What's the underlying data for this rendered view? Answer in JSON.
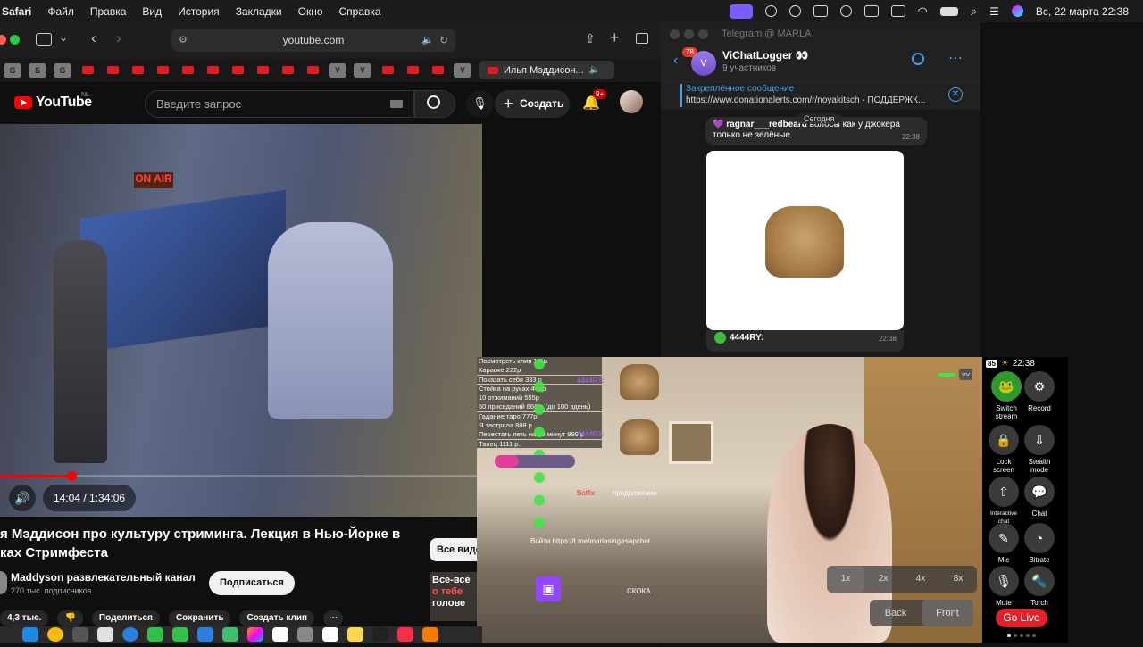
{
  "menubar": {
    "app": "Safari",
    "items": [
      "Файл",
      "Правка",
      "Вид",
      "История",
      "Закладки",
      "Окно",
      "Справка"
    ],
    "datetime": "Вс, 22 марта  22:38"
  },
  "safari": {
    "url": "youtube.com",
    "active_tab_title": "Илья Мэддисон..."
  },
  "youtube": {
    "logo_text": "YouTube",
    "region": "NL",
    "search_placeholder": "Введите запрос",
    "create_label": "Создать",
    "notifications_badge": "9+",
    "player": {
      "current_time": "14:04",
      "duration": "1:34:06",
      "progress_fraction": 0.149
    },
    "title_line1": "я Мэддисон про культуру стриминга. Лекция в Нью-Йорке в",
    "title_line2": "ках Стримфеста",
    "channel_name": "Maddyson развлекательный канал",
    "subscribers": "270 тыс. подписчиков",
    "subscribe_label": "Подписаться",
    "likes": "4,3 тыс.",
    "share_label": "Поделиться",
    "save_label": "Сохранить",
    "clip_label": "Создать клип",
    "see_all_label": "Все видео",
    "side_thumb_text_1": "Все-все",
    "side_thumb_text_2": "о тебе",
    "side_thumb_text_3": "голове"
  },
  "telegram": {
    "window_title": "Telegram @ MARLA",
    "unread_badge": "78",
    "chat_name": "ViChatLogger 👀",
    "members": "9 участников",
    "avatar_letter": "V",
    "pinned_label": "Закреплённое сообщение",
    "pinned_text": "https://www.donationalerts.com/r/noyakitsch - ПОДДЕРЖК...",
    "date_divider": "Сегодня",
    "msg1_author": "ragnar___redbeard",
    "msg1_text_a": "волосы как у джокера",
    "msg1_text_b": "только не зелёные",
    "msg1_time": "22:38",
    "msg2_author": "4444RY:",
    "msg2_time": "22:38"
  },
  "stream": {
    "menu_items": [
      "Посмотреть клип 111р",
      "Караоке 222р",
      "Показать себя 333 р",
      "Стойка на руках 444р",
      "10 отжиманий 555р",
      "50 приседаний 666 р (до 100 вдень)",
      "Гадание таро 777р",
      "Я застряла 888 р",
      "Перестать петь на 30 минут 999 р",
      "Танец 1111 р."
    ],
    "chat_user_1": "4444RY:",
    "chat_user_2": "4444RY:",
    "bottom_chat_1": "Botfix",
    "bottom_chat_2": "продолжение",
    "link_text": "Войти https://t.me/marlasing/rsapchat",
    "bottom_tag": "СКОКА",
    "zoom_options": [
      "1x",
      "2x",
      "4x",
      "8x"
    ],
    "camera_back": "Back",
    "camera_front": "Front"
  },
  "phone_panel": {
    "battery": "85",
    "time": "22:38",
    "buttons": [
      {
        "label": "Switch stream"
      },
      {
        "label": "Record"
      },
      {
        "label": "Lock screen"
      },
      {
        "label": "Stealth mode"
      },
      {
        "label": "Interactive chat"
      },
      {
        "label": "Chat"
      },
      {
        "label": "Mic"
      },
      {
        "label": "Bitrate"
      },
      {
        "label": "Mute"
      },
      {
        "label": "Torch"
      }
    ],
    "go_live_label": "Go Live"
  }
}
